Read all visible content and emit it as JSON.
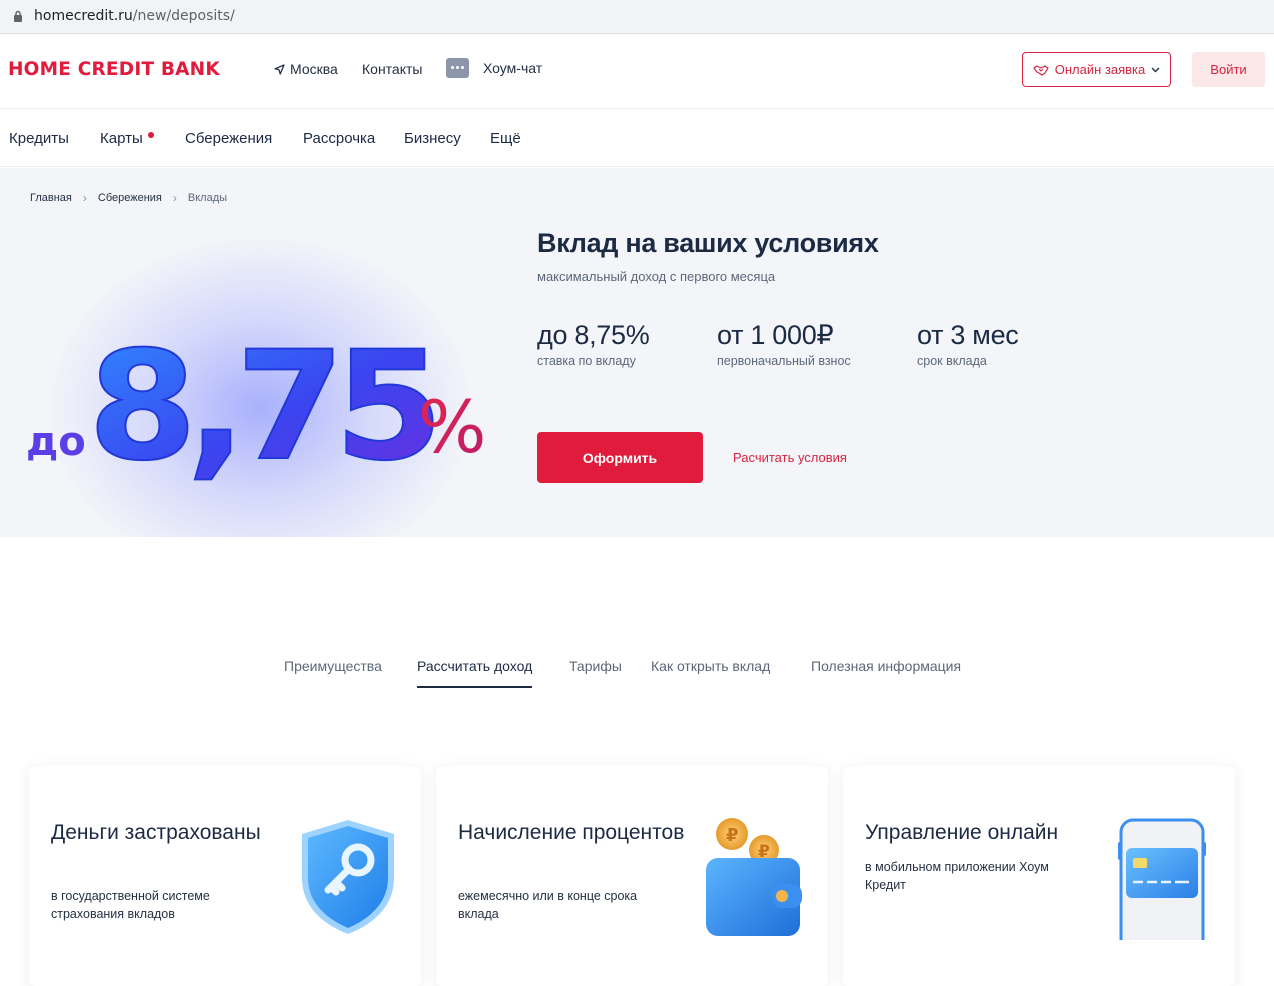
{
  "browser": {
    "url_host": "homecredit.ru",
    "url_path": "/new/deposits/"
  },
  "header": {
    "logo": "HOME CREDIT BANK",
    "city": "Москва",
    "contacts": "Контакты",
    "chat": "Хоум-чат",
    "apply_label": "Онлайн заявка",
    "login_label": "Войти"
  },
  "nav": [
    "Кредиты",
    "Карты",
    "Сбережения",
    "Рассрочка",
    "Бизнесу",
    "Ещё"
  ],
  "breadcrumbs": [
    "Главная",
    "Сбережения",
    "Вклады"
  ],
  "hero": {
    "big_prefix": "до",
    "big_rate": "8,75",
    "big_percent": "%",
    "title": "Вклад на ваших условиях",
    "subtitle": "максимальный доход с первого месяца",
    "stats": [
      {
        "value": "до 8,75%",
        "label": "ставка по вкладу"
      },
      {
        "value": "от 1 000₽",
        "label": "первоначальный взнос"
      },
      {
        "value": "от 3 мес",
        "label": "срок вклада"
      }
    ],
    "cta": "Оформить",
    "calc_link": "Расчитать условия"
  },
  "tabs": [
    "Преимущества",
    "Рассчитать доход",
    "Тарифы",
    "Как открыть вклад",
    "Полезная информация"
  ],
  "active_tab": "Рассчитать доход",
  "cards": [
    {
      "title": "Деньги застрахованы",
      "desc": "в государственной системе страхования вкладов",
      "icon": "shield-key-icon"
    },
    {
      "title": "Начисление процентов",
      "desc": "ежемесячно или в конце срока вклада",
      "icon": "wallet-coins-icon"
    },
    {
      "title": "Управление онлайн",
      "desc": "в мобильном приложении Хоум Кредит",
      "icon": "phone-card-icon"
    }
  ],
  "colors": {
    "brand": "#e11b3c",
    "text": "#1c2a44",
    "hero_bg": "#f4f5f9"
  }
}
